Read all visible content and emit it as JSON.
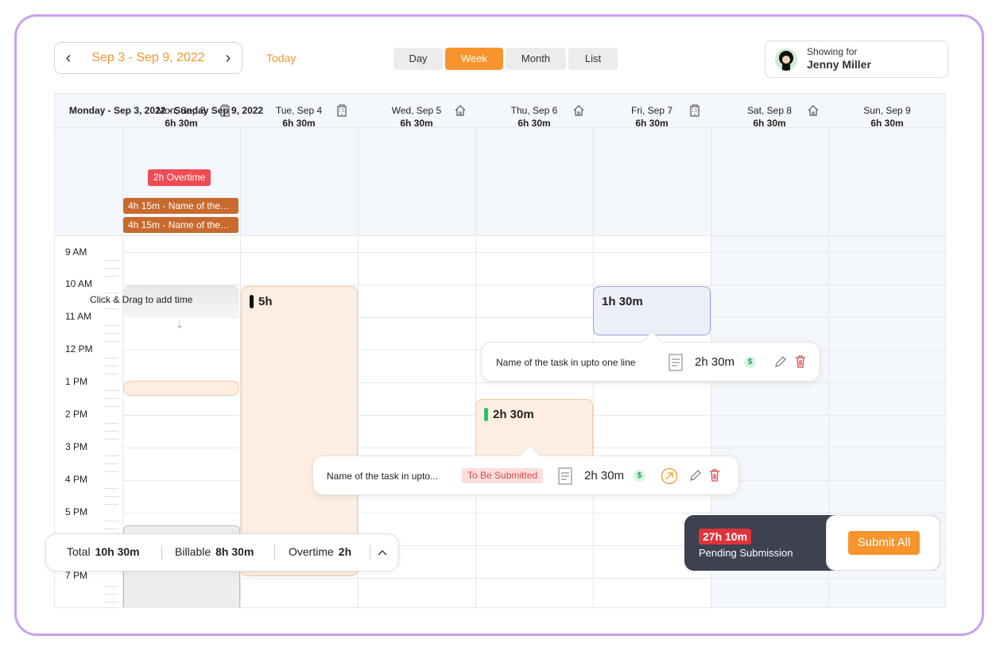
{
  "header": {
    "date_range": "Sep 3 - Sep 9, 2022",
    "prev_icon": "chevron-left-icon",
    "next_icon": "chevron-right-icon",
    "today_label": "Today",
    "views": [
      "Day",
      "Week",
      "Month",
      "List"
    ],
    "active_view": "Week",
    "showing_for_label": "Showing for",
    "user_name": "Jenny Miller"
  },
  "calendar": {
    "title": "Monday - Sep 3, 2022 - Sunday Sep 9, 2022",
    "days": [
      {
        "label": "Mon, Sep 3",
        "hours": "6h 30m",
        "icon": "office-building-icon"
      },
      {
        "label": "Tue, Sep 4",
        "hours": "6h 30m",
        "icon": "office-building-icon"
      },
      {
        "label": "Wed, Sep 5",
        "hours": "6h 30m",
        "icon": "home-icon"
      },
      {
        "label": "Thu, Sep 6",
        "hours": "6h 30m",
        "icon": "home-icon"
      },
      {
        "label": "Fri, Sep 7",
        "hours": "6h 30m",
        "icon": "office-building-icon"
      },
      {
        "label": "Sat, Sep 8",
        "hours": "6h 30m",
        "icon": "home-icon"
      },
      {
        "label": "Sun, Sep 9",
        "hours": "6h 30m",
        "icon": ""
      }
    ],
    "overtime_badge": "2h Overtime",
    "allday_events": [
      "4h 15m - Name of the…",
      "4h 15m - Name of the…"
    ],
    "times": [
      "9 AM",
      "10 AM",
      "11 AM",
      "12 PM",
      "1 PM",
      "2 PM",
      "3 PM",
      "4 PM",
      "5 PM",
      "7 PM"
    ],
    "drag_hint": "Click & Drag to add time",
    "blocks": {
      "tue": "5h",
      "fri": "1h 30m",
      "thu": "2h 30m"
    },
    "colors": {
      "accent": "#f7942d",
      "overtime": "#ef4b55",
      "allday": "#c86a2e",
      "green_pill": "#22c36b",
      "black_pill": "#111111"
    }
  },
  "popup_fri": {
    "task_name": "Name of the task in upto one line",
    "duration": "2h 30m",
    "billable_symbol": "$"
  },
  "popup_thu": {
    "task_name": "Name of the task in upto...",
    "status": "To Be Submitted",
    "duration": "2h 30m",
    "billable_symbol": "$"
  },
  "totals": {
    "total_label": "Total",
    "total_value": "10h 30m",
    "billable_label": "Billable",
    "billable_value": "8h 30m",
    "overtime_label": "Overtime",
    "overtime_value": "2h"
  },
  "pending": {
    "amount": "27h 10m",
    "label": "Pending Submission",
    "submit_label": "Submit All"
  }
}
